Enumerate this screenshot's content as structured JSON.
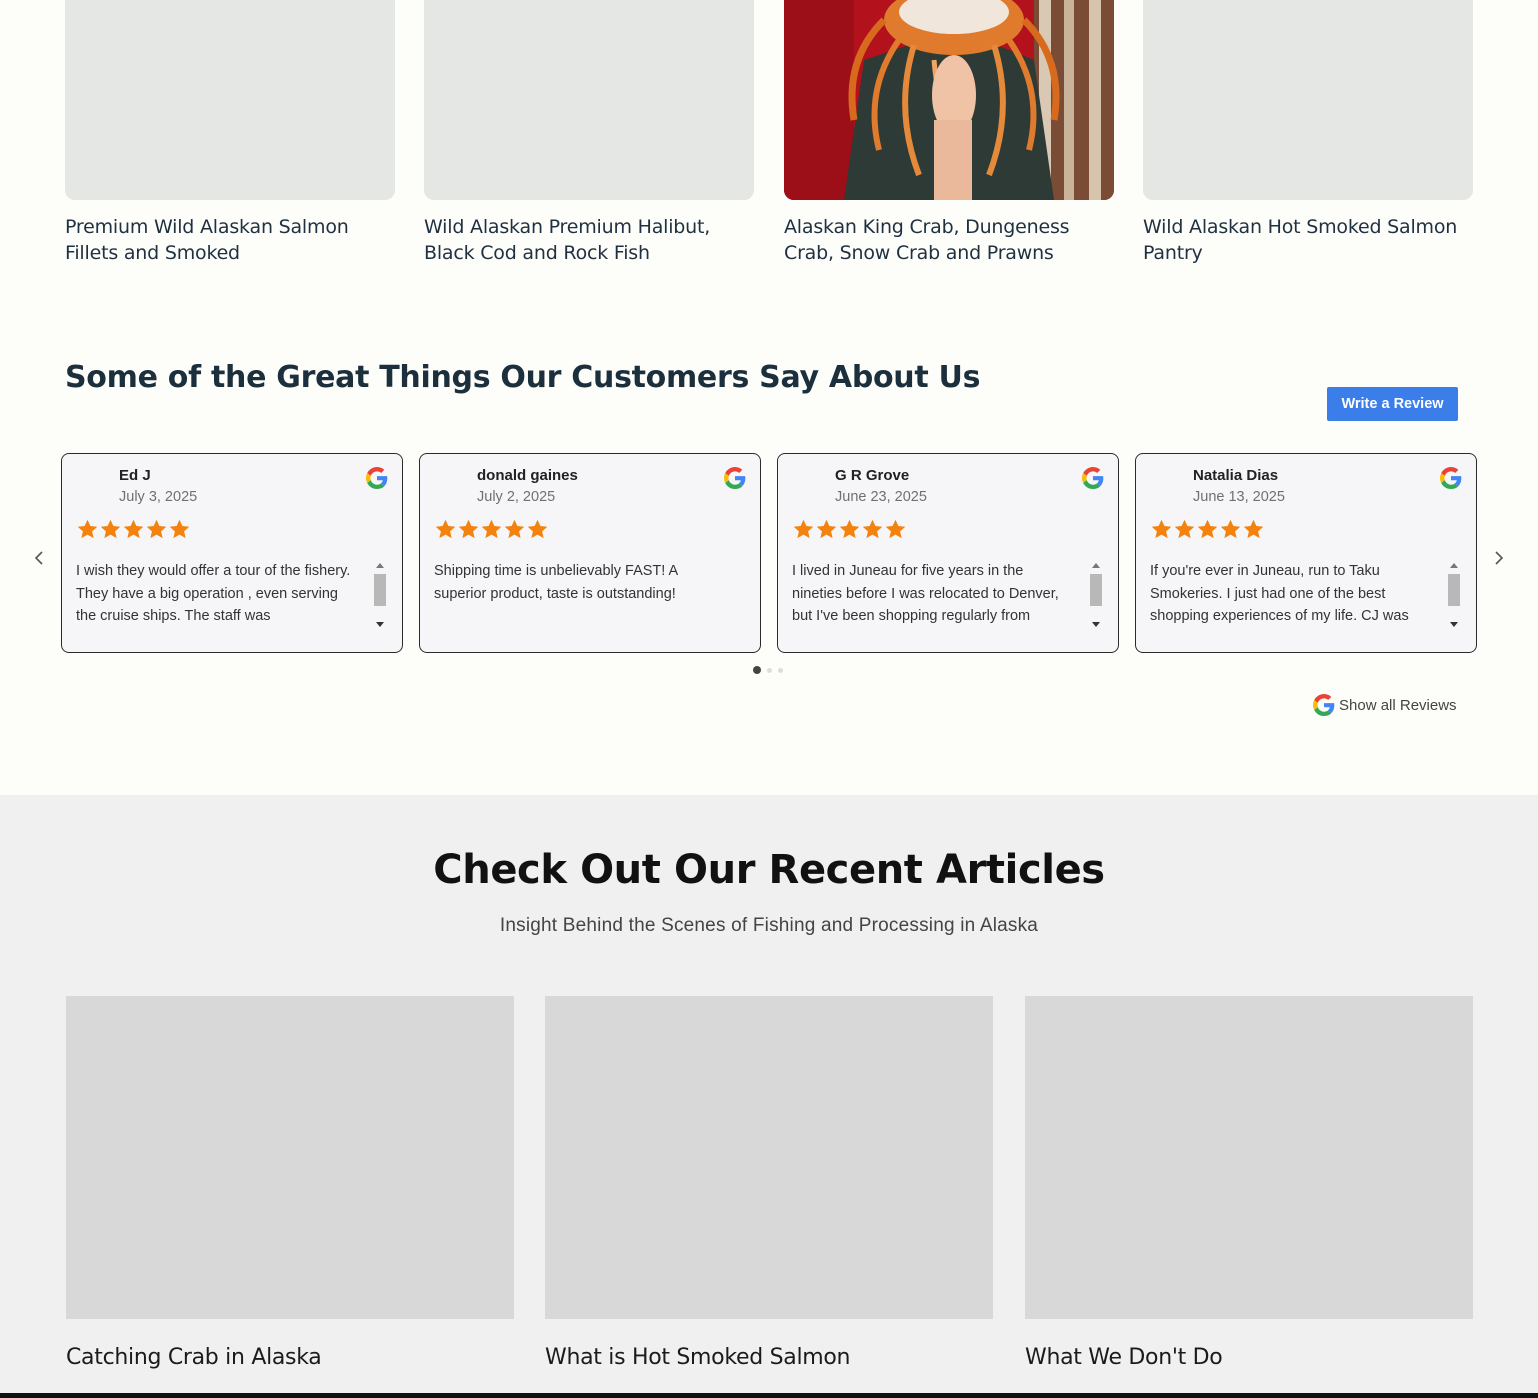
{
  "products": [
    {
      "title": "Premium Wild Alaskan Salmon Fillets and Smoked",
      "has_image": false
    },
    {
      "title": "Wild Alaskan Premium Halibut, Black Cod and Rock Fish",
      "has_image": false
    },
    {
      "title": "Alaskan King Crab, Dungeness Crab, Snow Crab and Prawns",
      "has_image": true
    },
    {
      "title": "Wild Alaskan Hot Smoked Salmon Pantry",
      "has_image": false
    }
  ],
  "reviews_section": {
    "heading": "Some of the Great Things Our Customers Say About Us",
    "write_review_label": "Write a Review",
    "show_all_label": "Show all Reviews",
    "star_color": "#f3820f",
    "reviews": [
      {
        "name": "Ed J",
        "date": "July 3, 2025",
        "rating": 5,
        "text": "I wish they would offer a tour of the fishery. They have a big operation , even serving the cruise ships. The staff was",
        "scrollable": true
      },
      {
        "name": "donald gaines",
        "date": "July 2, 2025",
        "rating": 5,
        "text": "Shipping time is unbelievably FAST! A superior product, taste is outstanding!",
        "scrollable": false
      },
      {
        "name": "G R Grove",
        "date": "June 23, 2025",
        "rating": 5,
        "text": "I lived in Juneau for five years in the nineties before I was relocated to Denver, but I've been shopping regularly from",
        "scrollable": true
      },
      {
        "name": "Natalia Dias",
        "date": "June 13, 2025",
        "rating": 5,
        "text": "If you're ever in Juneau, run to Taku Smokeries. I just had one of the best shopping experiences of my life. CJ was",
        "scrollable": true
      }
    ],
    "pager": {
      "pages": 3,
      "active": 0
    }
  },
  "articles_section": {
    "title": "Check Out Our Recent Articles",
    "subtitle": "Insight Behind the Scenes of Fishing and Processing in Alaska",
    "articles": [
      {
        "title": "Catching Crab in Alaska"
      },
      {
        "title": "What is Hot Smoked Salmon"
      },
      {
        "title": "What We Don't Do"
      }
    ]
  },
  "colors": {
    "accent_button": "#3b7de9",
    "page_bg": "#fdfdfa",
    "articles_bg": "#f0f0f1"
  }
}
